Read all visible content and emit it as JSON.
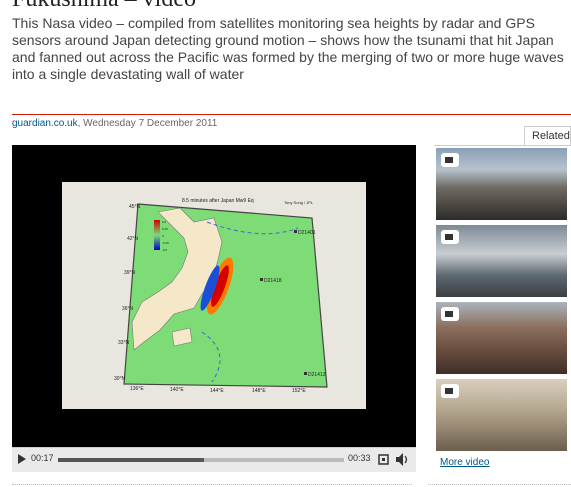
{
  "article": {
    "headline": "Fukushima – video",
    "standfirst": "This Nasa video – compiled from satellites monitoring sea heights by radar and GPS sensors around Japan detecting ground motion – shows how the tsunami that hit Japan and fanned out across the Pacific was formed by the merging of two or more huge waves into a single devastating wall of water",
    "source": "guardian.co.uk",
    "date": ", Wednesday 7 December 2011"
  },
  "player": {
    "map_title": "8.5 minutes after Japan Mw9 Eq",
    "map_credit": "Tony Song / JPL",
    "lat_labels": [
      "45°N",
      "42°N",
      "39°N",
      "36°N",
      "33°N",
      "30°N"
    ],
    "lon_labels": [
      "136°E",
      "140°E",
      "144°E",
      "148°E",
      "152°E"
    ],
    "buoys": [
      "D21401",
      "D21418",
      "D21413"
    ],
    "colorbar_labels": [
      "0.5",
      "0.25",
      "0",
      "-0.25",
      "-0.5"
    ],
    "current_time": "00:17",
    "total_time": "00:33",
    "progress": 0.51
  },
  "sidebar": {
    "tab_label": "Related",
    "more_link": "More video"
  },
  "icons": {
    "play": "play-icon",
    "fullscreen": "fullscreen-icon",
    "volume": "volume-icon",
    "video": "video-camera-icon"
  },
  "colors": {
    "link": "#005689",
    "rule": "#d61d00",
    "player_bg": "#000000"
  }
}
